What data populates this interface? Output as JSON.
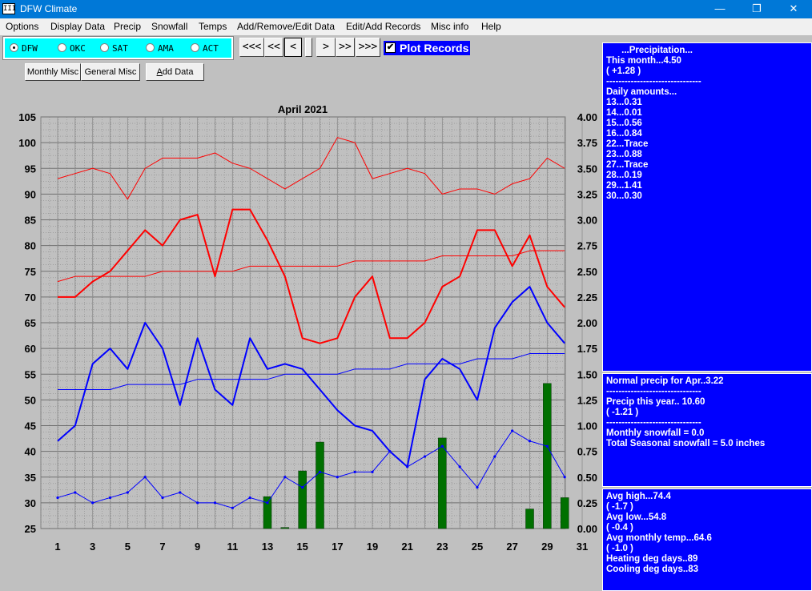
{
  "window": {
    "title": "DFW Climate",
    "icon": "III",
    "minimize_glyph": "—",
    "restore_glyph": "❐",
    "close_glyph": "✕"
  },
  "menu": [
    "Options",
    "Display Data",
    "Precip",
    "Snowfall",
    "Temps",
    "Add/Remove/Edit Data",
    "Edit/Add Records",
    "Misc info",
    "Help"
  ],
  "stations": [
    {
      "label": "DFW",
      "selected": true
    },
    {
      "label": "OKC",
      "selected": false
    },
    {
      "label": "SAT",
      "selected": false
    },
    {
      "label": "AMA",
      "selected": false
    },
    {
      "label": "ACT",
      "selected": false
    }
  ],
  "nav_buttons": [
    "<<<",
    "<<",
    "<",
    "",
    ">",
    ">>",
    ">>>"
  ],
  "plot_records": {
    "label": "Plot Records",
    "checked": true,
    "check_glyph": "✔"
  },
  "buttons": {
    "monthly_misc": "Monthly Misc",
    "general_misc": "General Misc",
    "add_data_underline": "A",
    "add_data_rest": "dd Data"
  },
  "precip_panel": [
    "      ...Precipitation...",
    "This month...4.50",
    "( +1.28 )",
    "-------------------------------",
    "Daily amounts...",
    "13...0.31",
    "14...0.01",
    "15...0.56",
    "16...0.84",
    "22...Trace",
    "23...0.88",
    "27...Trace",
    "28...0.19",
    "29...1.41",
    "30...0.30"
  ],
  "normals_panel": [
    "Normal precip for Apr..3.22",
    "-------------------------------",
    "Precip this year.. 10.60",
    "( -1.21 )",
    "-------------------------------",
    "Monthly snowfall = 0.0",
    "Total Seasonal snowfall = 5.0 inches"
  ],
  "temps_panel": [
    "Avg high...74.4",
    "( -1.7 )",
    "Avg low...54.8",
    "( -0.4 )",
    "Avg monthly temp...64.6",
    "( -1.0 )",
    "Heating deg days..89",
    "Cooling deg days..83"
  ],
  "chart_data": {
    "type": "line",
    "title": "April 2021",
    "xlabel": "",
    "ylabel": "",
    "x_ticks": [
      1,
      3,
      5,
      7,
      9,
      11,
      13,
      15,
      17,
      19,
      21,
      23,
      25,
      27,
      29,
      31
    ],
    "xlim": [
      1,
      31
    ],
    "ylim": [
      25,
      105
    ],
    "y_ticks": [
      105,
      100,
      95,
      90,
      85,
      80,
      75,
      70,
      65,
      60,
      55,
      50,
      45,
      40,
      35,
      30,
      25
    ],
    "y2lim": [
      0,
      4
    ],
    "y2_ticks": [
      "4.00",
      "3.75",
      "3.50",
      "3.25",
      "3.00",
      "2.75",
      "2.50",
      "2.25",
      "2.00",
      "1.75",
      "1.50",
      "1.25",
      "1.00",
      "0.75",
      "0.50",
      "0.25",
      "0.00"
    ],
    "grid": true,
    "series": [
      {
        "color": "#ff0000",
        "x": [
          1,
          2,
          3,
          4,
          5,
          6,
          7,
          8,
          9,
          10,
          11,
          12,
          13,
          14,
          15,
          16,
          17,
          18,
          19,
          20,
          21,
          22,
          23,
          24,
          25,
          26,
          27,
          28,
          29,
          30
        ],
        "values": [
          93,
          94,
          95,
          94,
          89,
          95,
          97,
          97,
          97,
          98,
          96,
          95,
          93,
          91,
          93,
          95,
          101,
          100,
          93,
          94,
          95,
          94,
          90,
          91,
          91,
          90,
          92,
          93,
          97,
          95
        ]
      },
      {
        "color": "#ff0000",
        "x": [
          1,
          2,
          3,
          4,
          5,
          6,
          7,
          8,
          9,
          10,
          11,
          12,
          13,
          14,
          15,
          16,
          17,
          18,
          19,
          20,
          21,
          22,
          23,
          24,
          25,
          26,
          27,
          28,
          29,
          30
        ],
        "values": [
          73,
          74,
          74,
          74,
          74,
          74,
          75,
          75,
          75,
          75,
          75,
          76,
          76,
          76,
          76,
          76,
          76,
          77,
          77,
          77,
          77,
          77,
          78,
          78,
          78,
          78,
          78,
          79,
          79,
          79
        ]
      },
      {
        "color": "#ff0000",
        "x": [
          1,
          2,
          3,
          4,
          5,
          6,
          7,
          8,
          9,
          10,
          11,
          12,
          13,
          14,
          15,
          16,
          17,
          18,
          19,
          20,
          21,
          22,
          23,
          24,
          25,
          26,
          27,
          28,
          29,
          30
        ],
        "values": [
          70,
          70,
          73,
          75,
          79,
          83,
          80,
          85,
          86,
          74,
          87,
          87,
          81,
          74,
          62,
          61,
          62,
          70,
          74,
          62,
          62,
          65,
          72,
          74,
          83,
          83,
          76,
          82,
          72,
          68
        ]
      },
      {
        "color": "#0000ff",
        "x": [
          1,
          2,
          3,
          4,
          5,
          6,
          7,
          8,
          9,
          10,
          11,
          12,
          13,
          14,
          15,
          16,
          17,
          18,
          19,
          20,
          21,
          22,
          23,
          24,
          25,
          26,
          27,
          28,
          29,
          30
        ],
        "values": [
          42,
          45,
          57,
          60,
          56,
          65,
          60,
          49,
          62,
          52,
          49,
          62,
          56,
          57,
          56,
          52,
          48,
          45,
          44,
          40,
          37,
          54,
          58,
          56,
          50,
          64,
          69,
          72,
          65,
          61
        ]
      },
      {
        "color": "#0000ff",
        "x": [
          1,
          2,
          3,
          4,
          5,
          6,
          7,
          8,
          9,
          10,
          11,
          12,
          13,
          14,
          15,
          16,
          17,
          18,
          19,
          20,
          21,
          22,
          23,
          24,
          25,
          26,
          27,
          28,
          29,
          30
        ],
        "values": [
          52,
          52,
          52,
          52,
          53,
          53,
          53,
          53,
          54,
          54,
          54,
          54,
          54,
          55,
          55,
          55,
          55,
          56,
          56,
          56,
          57,
          57,
          57,
          57,
          58,
          58,
          58,
          59,
          59,
          59
        ]
      },
      {
        "color": "#0000ff",
        "x": [
          1,
          2,
          3,
          4,
          5,
          6,
          7,
          8,
          9,
          10,
          11,
          12,
          13,
          14,
          15,
          16,
          17,
          18,
          19,
          20,
          21,
          22,
          23,
          24,
          25,
          26,
          27,
          28,
          29,
          30
        ],
        "values": [
          31,
          32,
          30,
          31,
          32,
          35,
          31,
          32,
          30,
          30,
          29,
          31,
          30,
          35,
          33,
          36,
          35,
          36,
          36,
          40,
          37,
          39,
          41,
          37,
          33,
          39,
          44,
          42,
          41,
          35
        ]
      }
    ],
    "precip_bars": {
      "color": "#007000",
      "x": [
        13,
        14,
        15,
        16,
        23,
        28,
        29,
        30
      ],
      "values": [
        0.31,
        0.01,
        0.56,
        0.84,
        0.88,
        0.19,
        1.41,
        0.3
      ]
    }
  }
}
